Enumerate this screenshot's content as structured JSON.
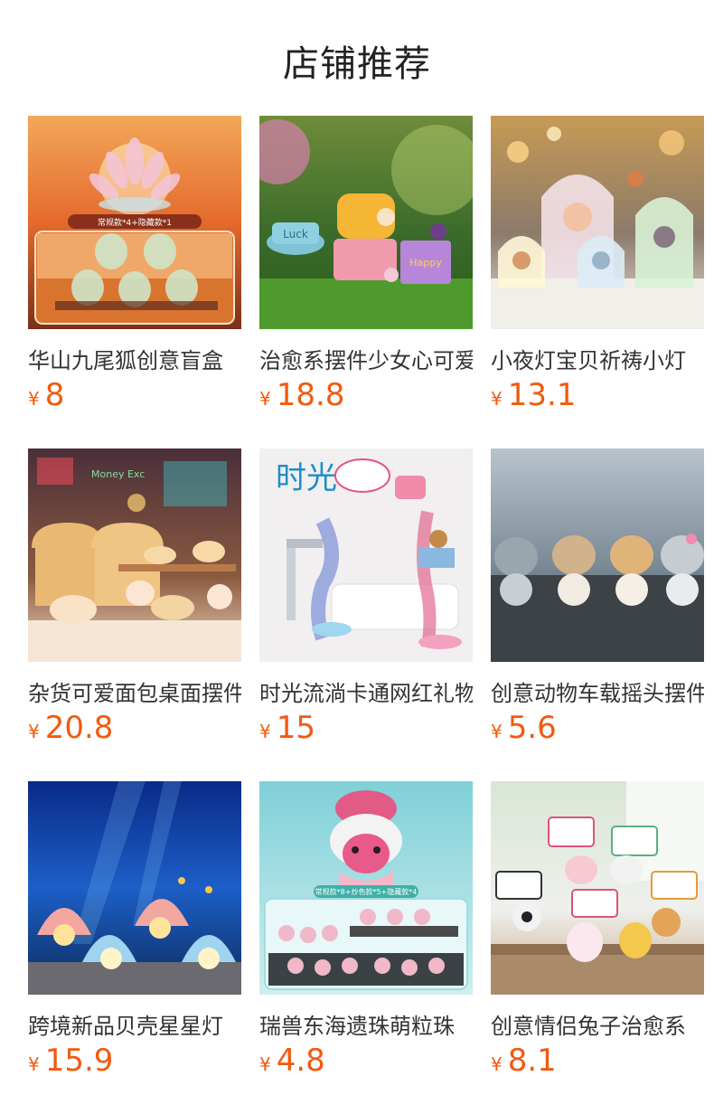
{
  "header": {
    "title": "店铺推荐"
  },
  "products": [
    {
      "name": "华山九尾狐创意盲盒",
      "currency": "¥",
      "price": "8",
      "image_badge": "常规款*4+隐藏款*1"
    },
    {
      "name": "治愈系摆件少女心可爱",
      "currency": "¥",
      "price": "18.8",
      "image_text": "Luck"
    },
    {
      "name": "小夜灯宝贝祈祷小灯",
      "currency": "¥",
      "price": "13.1"
    },
    {
      "name": "杂货可爱面包桌面摆件",
      "currency": "¥",
      "price": "20.8",
      "image_text": "Money Exc"
    },
    {
      "name": "时光流淌卡通网红礼物",
      "currency": "¥",
      "price": "15",
      "image_text": "时光"
    },
    {
      "name": "创意动物车载摇头摆件",
      "currency": "¥",
      "price": "5.6"
    },
    {
      "name": "跨境新品贝壳星星灯",
      "currency": "¥",
      "price": "15.9"
    },
    {
      "name": "瑞兽东海遗珠萌粒珠",
      "currency": "¥",
      "price": "4.8",
      "image_badge": "常规款*8+炒色款*5+隐藏款*4"
    },
    {
      "name": "创意情侣兔子治愈系",
      "currency": "¥",
      "price": "8.1"
    }
  ]
}
